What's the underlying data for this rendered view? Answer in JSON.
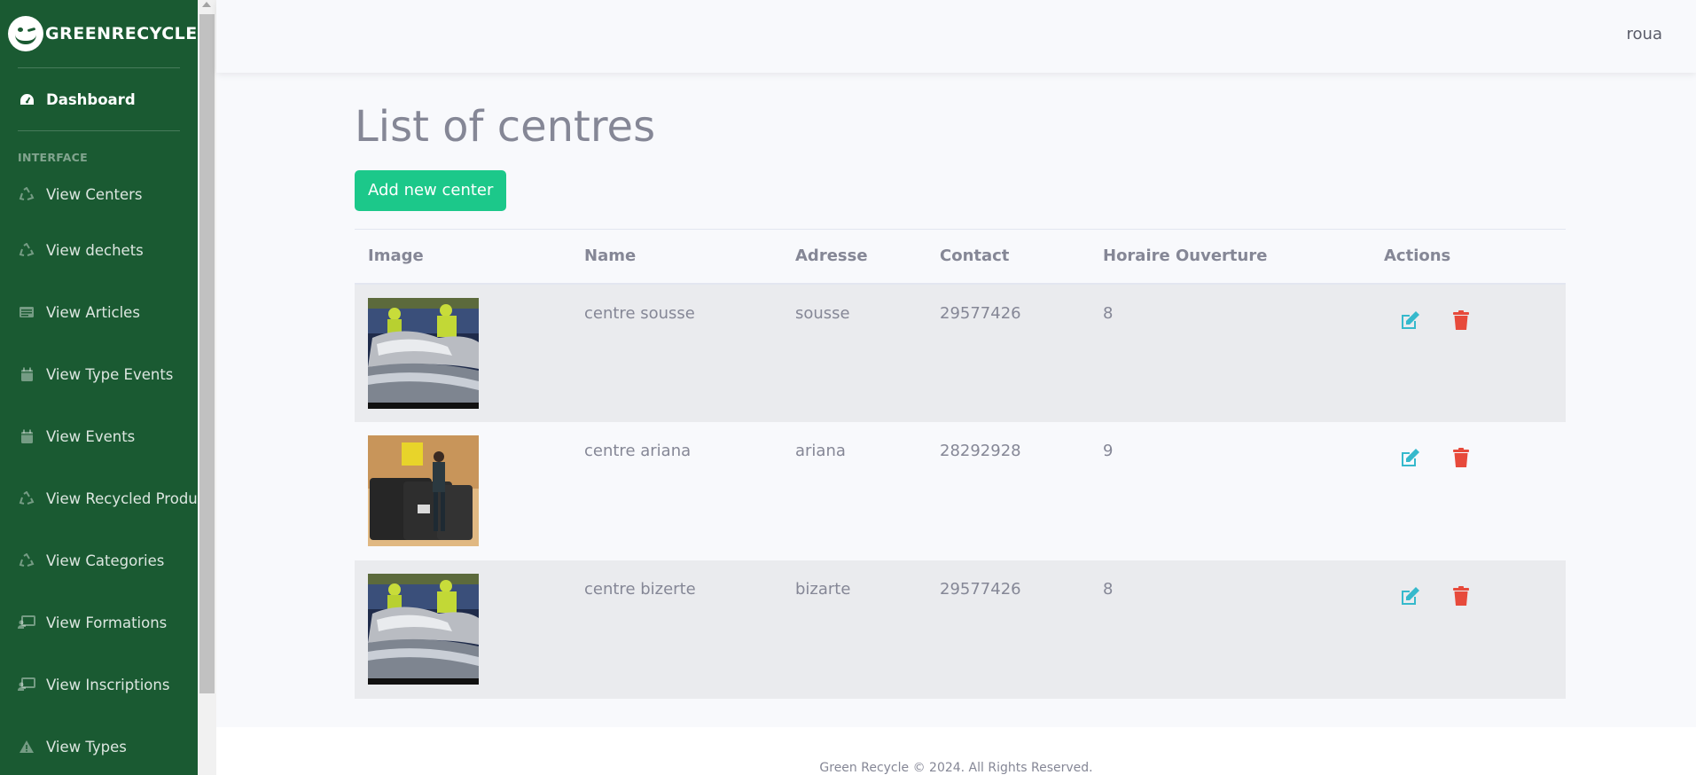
{
  "brand": {
    "name": "GREENRECYCLE"
  },
  "sidebar": {
    "dashboard": {
      "label": "Dashboard",
      "icon": "tachometer-icon"
    },
    "section_heading": "INTERFACE",
    "items": [
      {
        "label": "View Centers",
        "icon": "recycle-icon"
      },
      {
        "label": "View dechets",
        "icon": "recycle-icon"
      },
      {
        "label": "View Articles",
        "icon": "newspaper-icon"
      },
      {
        "label": "View Type Events",
        "icon": "calendar-icon"
      },
      {
        "label": "View Events",
        "icon": "calendar-icon"
      },
      {
        "label": "View Recycled Products",
        "icon": "recycle-icon"
      },
      {
        "label": "View Categories",
        "icon": "recycle-icon"
      },
      {
        "label": "View Formations",
        "icon": "chalkboard-teacher-icon"
      },
      {
        "label": "View Inscriptions",
        "icon": "chalkboard-teacher-icon"
      },
      {
        "label": "View Types",
        "icon": "warning-icon"
      }
    ]
  },
  "topbar": {
    "user": "roua"
  },
  "main": {
    "title": "List of centres",
    "add_button": "Add new center",
    "table": {
      "headers": [
        "Image",
        "Name",
        "Adresse",
        "Contact",
        "Horaire Ouverture",
        "Actions"
      ],
      "rows": [
        {
          "image": "recycling-conveyor-photo",
          "name": "centre sousse",
          "adresse": "sousse",
          "contact": "29577426",
          "horaire": "8"
        },
        {
          "image": "recycling-bins-photo",
          "name": "centre ariana",
          "adresse": "ariana",
          "contact": "28292928",
          "horaire": "9"
        },
        {
          "image": "recycling-conveyor-photo",
          "name": "centre bizerte",
          "adresse": "bizarte",
          "contact": "29577426",
          "horaire": "8"
        }
      ]
    }
  },
  "footer": {
    "text": "Green Recycle © 2024. All Rights Reserved."
  },
  "colors": {
    "sidebar": "#1a5a32",
    "add_button": "#1cc88a",
    "edit_icon": "#36b9cc",
    "delete_icon": "#e74a3b"
  }
}
